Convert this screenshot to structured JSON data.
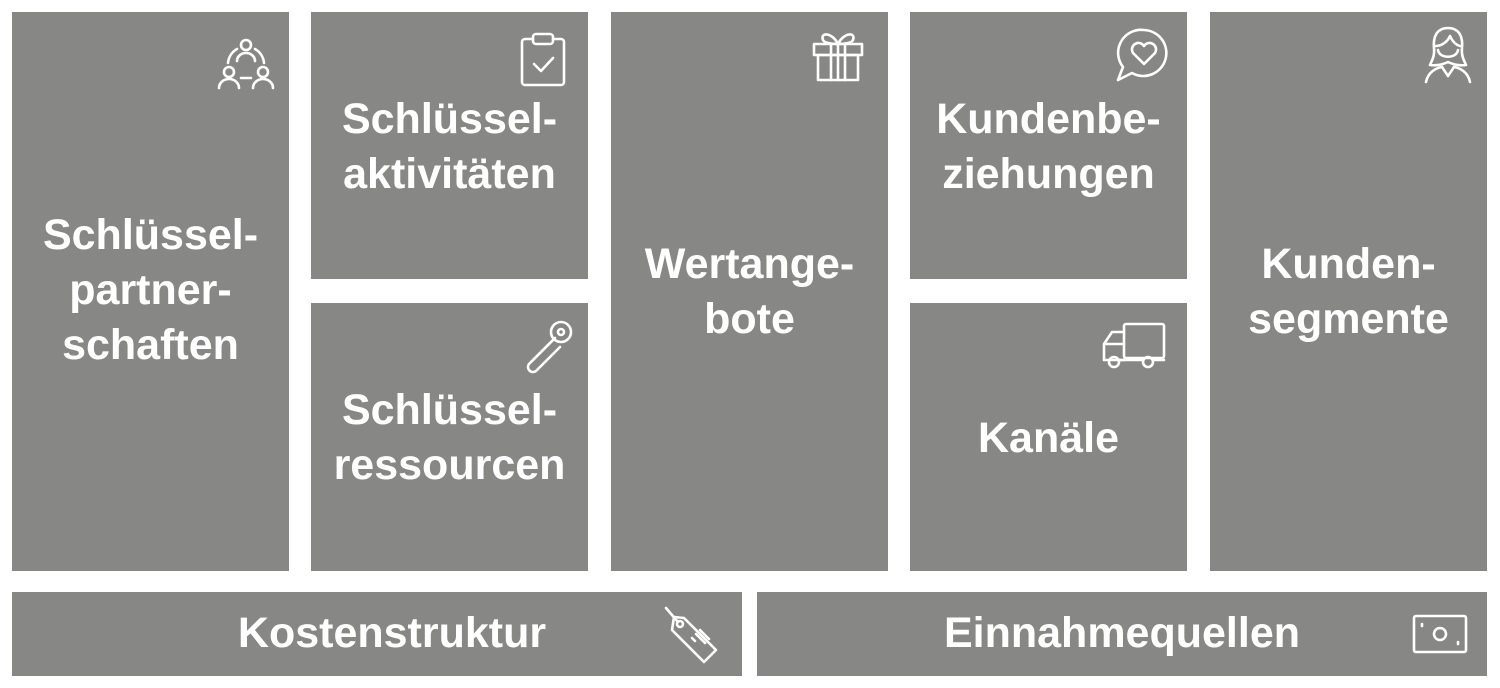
{
  "canvas": {
    "blocks": {
      "key_partners": {
        "label": "Schlüssel-\npartner-\nschaften",
        "icon": "partners-network-icon"
      },
      "key_activities": {
        "label": "Schlüssel-\naktivitäten",
        "icon": "clipboard-check-icon"
      },
      "key_resources": {
        "label": "Schlüssel-\nressourcen",
        "icon": "safety-pin-icon"
      },
      "value_propositions": {
        "label": "Wertange-\nbote",
        "icon": "gift-icon"
      },
      "customer_relationships": {
        "label": "Kundenbe-\nziehungen",
        "icon": "heart-speech-bubble-icon"
      },
      "channels": {
        "label": "Kanäle",
        "icon": "delivery-truck-icon"
      },
      "customer_segments": {
        "label": "Kunden-\nsegmente",
        "icon": "customer-person-icon"
      },
      "cost_structure": {
        "label": "Kostenstruktur",
        "icon": "price-tag-icon"
      },
      "revenue_streams": {
        "label": "Einnahmequellen",
        "icon": "banknote-icon"
      }
    },
    "colors": {
      "block": "#878786",
      "text": "#ffffff",
      "background": "#ffffff"
    }
  }
}
